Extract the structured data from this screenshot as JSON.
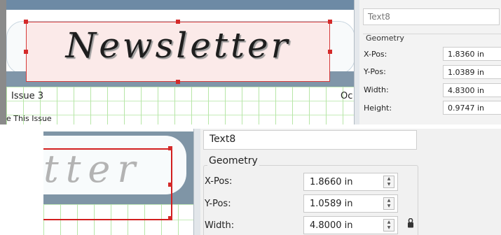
{
  "top": {
    "banner_title": "Newsletter",
    "issue_label": "Issue 3",
    "side_text": "Oc",
    "toc_text": "e This Issue",
    "panel": {
      "object_name": "Text8",
      "group_label": "Geometry",
      "rows": [
        {
          "label": "X-Pos:",
          "value": "1.8360 in"
        },
        {
          "label": "Y-Pos:",
          "value": "1.0389 in"
        },
        {
          "label": "Width:",
          "value": "4.8300 in"
        },
        {
          "label": "Height:",
          "value": "0.9747 in"
        }
      ]
    }
  },
  "bottom": {
    "banner_fragment": "tter",
    "panel": {
      "object_name": "Text8",
      "group_label": "Geometry",
      "rows": [
        {
          "label": "X-Pos:",
          "value": "1.8660 in"
        },
        {
          "label": "Y-Pos:",
          "value": "1.0589 in"
        },
        {
          "label": "Width:",
          "value": "4.8000 in"
        }
      ]
    }
  },
  "icons": [
    "spin-up-icon",
    "spin-down-icon",
    "chain-lock-icon"
  ]
}
